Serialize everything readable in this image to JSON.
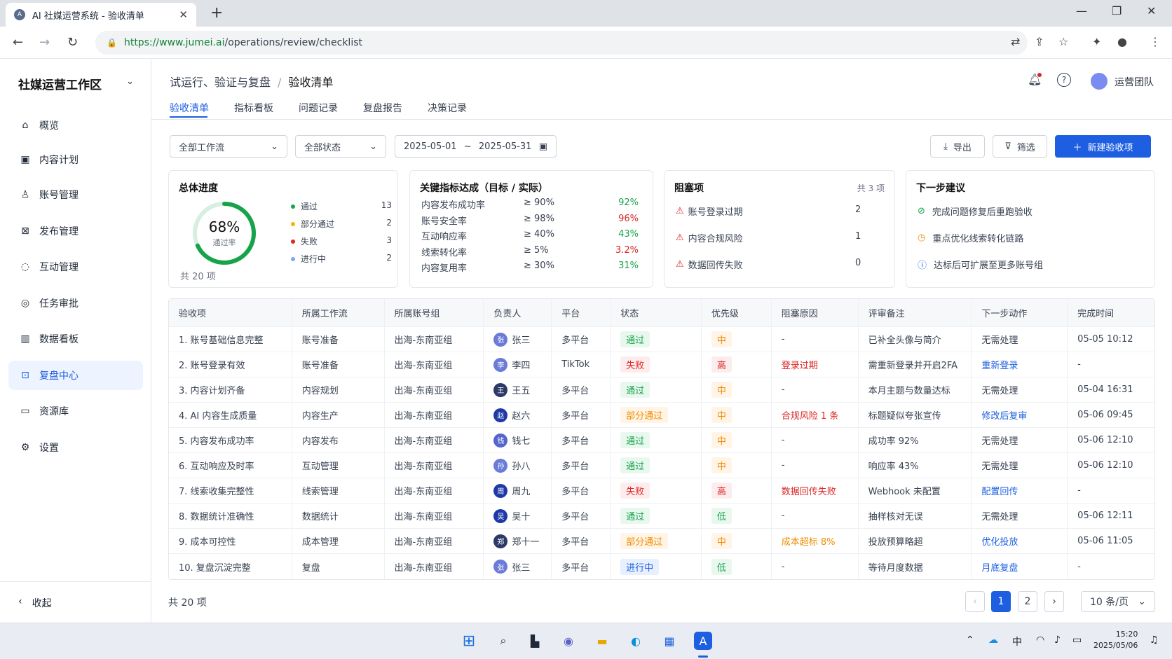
{
  "browser": {
    "tab_title": "AI 社媒运营系统 - 验收清单",
    "url_host": "https://www.jumei.ai",
    "url_path": "/operations/review/checklist"
  },
  "sidebar": {
    "workspace": "社媒运营工作区",
    "items": [
      {
        "label": "概览",
        "icon": "home-icon"
      },
      {
        "label": "内容计划",
        "icon": "calendar-icon"
      },
      {
        "label": "账号管理",
        "icon": "user-icon"
      },
      {
        "label": "发布管理",
        "icon": "publish-icon"
      },
      {
        "label": "互动管理",
        "icon": "chat-icon"
      },
      {
        "label": "任务审批",
        "icon": "approval-icon"
      },
      {
        "label": "数据看板",
        "icon": "bar-chart-icon"
      },
      {
        "label": "复盘中心",
        "icon": "review-icon",
        "active": true
      },
      {
        "label": "资源库",
        "icon": "folder-icon"
      },
      {
        "label": "设置",
        "icon": "gear-icon"
      }
    ],
    "collapse_label": "收起"
  },
  "header": {
    "breadcrumb_parent": "试运行、验证与复盘",
    "breadcrumb_sep": "/",
    "breadcrumb_current": "验收清单",
    "user_name": "运营团队"
  },
  "tabs": [
    "验收清单",
    "指标看板",
    "问题记录",
    "复盘报告",
    "决策记录"
  ],
  "filters": {
    "workflow": "全部工作流",
    "status": "全部状态",
    "date_start": "2025-05-01",
    "date_sep": "~",
    "date_end": "2025-05-31",
    "export_label": "导出",
    "filter_label": "筛选",
    "new_label": "新建验收项"
  },
  "progress_card": {
    "title": "总体进度",
    "percent": "68%",
    "percent_value": 0.68,
    "sub": "通过率",
    "total": "共 20 项",
    "legend": [
      {
        "label": "通过",
        "value": "13",
        "color": "#16a34a"
      },
      {
        "label": "部分通过",
        "value": "2",
        "color": "#f5b400"
      },
      {
        "label": "失败",
        "value": "3",
        "color": "#dc2626"
      },
      {
        "label": "进行中",
        "value": "2",
        "color": "#7ea6f0"
      }
    ]
  },
  "kpi_card": {
    "title": "关键指标达成（目标 / 实际）",
    "rows": [
      {
        "name": "内容发布成功率",
        "target": "≥ 90%",
        "actual": "92%",
        "ok": true
      },
      {
        "name": "账号安全率",
        "target": "≥ 98%",
        "actual": "96%",
        "ok": false
      },
      {
        "name": "互动响应率",
        "target": "≥ 40%",
        "actual": "43%",
        "ok": true
      },
      {
        "name": "线索转化率",
        "target": "≥ 5%",
        "actual": "3.2%",
        "ok": false
      },
      {
        "name": "内容复用率",
        "target": "≥ 30%",
        "actual": "31%",
        "ok": true
      }
    ]
  },
  "blocker_card": {
    "title": "阻塞项",
    "count": "共 3 项",
    "rows": [
      {
        "label": "账号登录过期",
        "value": "2"
      },
      {
        "label": "内容合规风险",
        "value": "1"
      },
      {
        "label": "数据回传失败",
        "value": "0"
      }
    ]
  },
  "suggest_card": {
    "title": "下一步建议",
    "rows": [
      {
        "label": "完成问题修复后重跑验收",
        "icon": "check-circle-icon",
        "color": "#16a34a"
      },
      {
        "label": "重点优化线索转化链路",
        "icon": "clock-icon",
        "color": "#f08c00"
      },
      {
        "label": "达标后可扩展至更多账号组",
        "icon": "info-icon",
        "color": "#1d5fe0"
      }
    ]
  },
  "table": {
    "columns": [
      "验收项",
      "所属工作流",
      "所属账号组",
      "负责人",
      "平台",
      "状态",
      "优先级",
      "阻塞原因",
      "评审备注",
      "下一步动作",
      "完成时间"
    ],
    "rows": [
      {
        "item": "1. 账号基础信息完整",
        "flow": "账号准备",
        "group": "出海-东南亚组",
        "owner": "张三",
        "owner_initial": "张",
        "platform": "多平台",
        "status": "通过",
        "status_type": "pass",
        "priority": "中",
        "priority_type": "mid",
        "blocker": "-",
        "blocker_type": "plain",
        "note": "已补全头像与简介",
        "action": "无需处理",
        "action_link": false,
        "time": "05-05 10:12"
      },
      {
        "item": "2. 账号登录有效",
        "flow": "账号准备",
        "group": "出海-东南亚组",
        "owner": "李四",
        "owner_initial": "李",
        "platform": "TikTok",
        "status": "失败",
        "status_type": "fail",
        "priority": "高",
        "priority_type": "high",
        "blocker": "登录过期",
        "blocker_type": "red",
        "note": "需重新登录并开启2FA",
        "action": "重新登录",
        "action_link": true,
        "time": "-"
      },
      {
        "item": "3. 内容计划齐备",
        "flow": "内容规划",
        "group": "出海-东南亚组",
        "owner": "王五",
        "owner_initial": "王",
        "platform": "多平台",
        "status": "通过",
        "status_type": "pass",
        "priority": "中",
        "priority_type": "mid",
        "blocker": "-",
        "blocker_type": "plain",
        "note": "本月主题与数量达标",
        "action": "无需处理",
        "action_link": false,
        "time": "05-04 16:31"
      },
      {
        "item": "4. AI 内容生成质量",
        "flow": "内容生产",
        "group": "出海-东南亚组",
        "owner": "赵六",
        "owner_initial": "赵",
        "platform": "多平台",
        "status": "部分通过",
        "status_type": "part",
        "priority": "中",
        "priority_type": "mid",
        "blocker": "合规风险 1 条",
        "blocker_type": "red",
        "note": "标题疑似夸张宣传",
        "action": "修改后复审",
        "action_link": true,
        "time": "05-06 09:45"
      },
      {
        "item": "5. 内容发布成功率",
        "flow": "内容发布",
        "group": "出海-东南亚组",
        "owner": "钱七",
        "owner_initial": "钱",
        "platform": "多平台",
        "status": "通过",
        "status_type": "pass",
        "priority": "中",
        "priority_type": "mid",
        "blocker": "-",
        "blocker_type": "plain",
        "note": "成功率 92%",
        "action": "无需处理",
        "action_link": false,
        "time": "05-06 12:10"
      },
      {
        "item": "6. 互动响应及时率",
        "flow": "互动管理",
        "group": "出海-东南亚组",
        "owner": "孙八",
        "owner_initial": "孙",
        "platform": "多平台",
        "status": "通过",
        "status_type": "pass",
        "priority": "中",
        "priority_type": "mid",
        "blocker": "-",
        "blocker_type": "plain",
        "note": "响应率 43%",
        "action": "无需处理",
        "action_link": false,
        "time": "05-06 12:10"
      },
      {
        "item": "7. 线索收集完整性",
        "flow": "线索管理",
        "group": "出海-东南亚组",
        "owner": "周九",
        "owner_initial": "周",
        "platform": "多平台",
        "status": "失败",
        "status_type": "fail",
        "priority": "高",
        "priority_type": "high",
        "blocker": "数据回传失败",
        "blocker_type": "red",
        "note": "Webhook 未配置",
        "action": "配置回传",
        "action_link": true,
        "time": "-"
      },
      {
        "item": "8. 数据统计准确性",
        "flow": "数据统计",
        "group": "出海-东南亚组",
        "owner": "吴十",
        "owner_initial": "吴",
        "platform": "多平台",
        "status": "通过",
        "status_type": "pass",
        "priority": "低",
        "priority_type": "low",
        "blocker": "-",
        "blocker_type": "plain",
        "note": "抽样核对无误",
        "action": "无需处理",
        "action_link": false,
        "time": "05-06 12:11"
      },
      {
        "item": "9. 成本可控性",
        "flow": "成本管理",
        "group": "出海-东南亚组",
        "owner": "郑十一",
        "owner_initial": "郑",
        "platform": "多平台",
        "status": "部分通过",
        "status_type": "part",
        "priority": "中",
        "priority_type": "mid",
        "blocker": "成本超标 8%",
        "blocker_type": "orange",
        "note": "投放预算略超",
        "action": "优化投放",
        "action_link": true,
        "time": "05-06 11:05"
      },
      {
        "item": "10. 复盘沉淀完整",
        "flow": "复盘",
        "group": "出海-东南亚组",
        "owner": "张三",
        "owner_initial": "张",
        "platform": "多平台",
        "status": "进行中",
        "status_type": "prog",
        "priority": "低",
        "priority_type": "low",
        "blocker": "-",
        "blocker_type": "plain",
        "note": "等待月度数据",
        "action": "月底复盘",
        "action_link": true,
        "time": "-"
      }
    ]
  },
  "footer": {
    "total": "共 20 项",
    "pages": [
      "1",
      "2"
    ],
    "current_page": "1",
    "page_size": "10 条/页"
  },
  "taskbar": {
    "time": "15:20",
    "date": "2025/05/06",
    "ime": "中"
  }
}
